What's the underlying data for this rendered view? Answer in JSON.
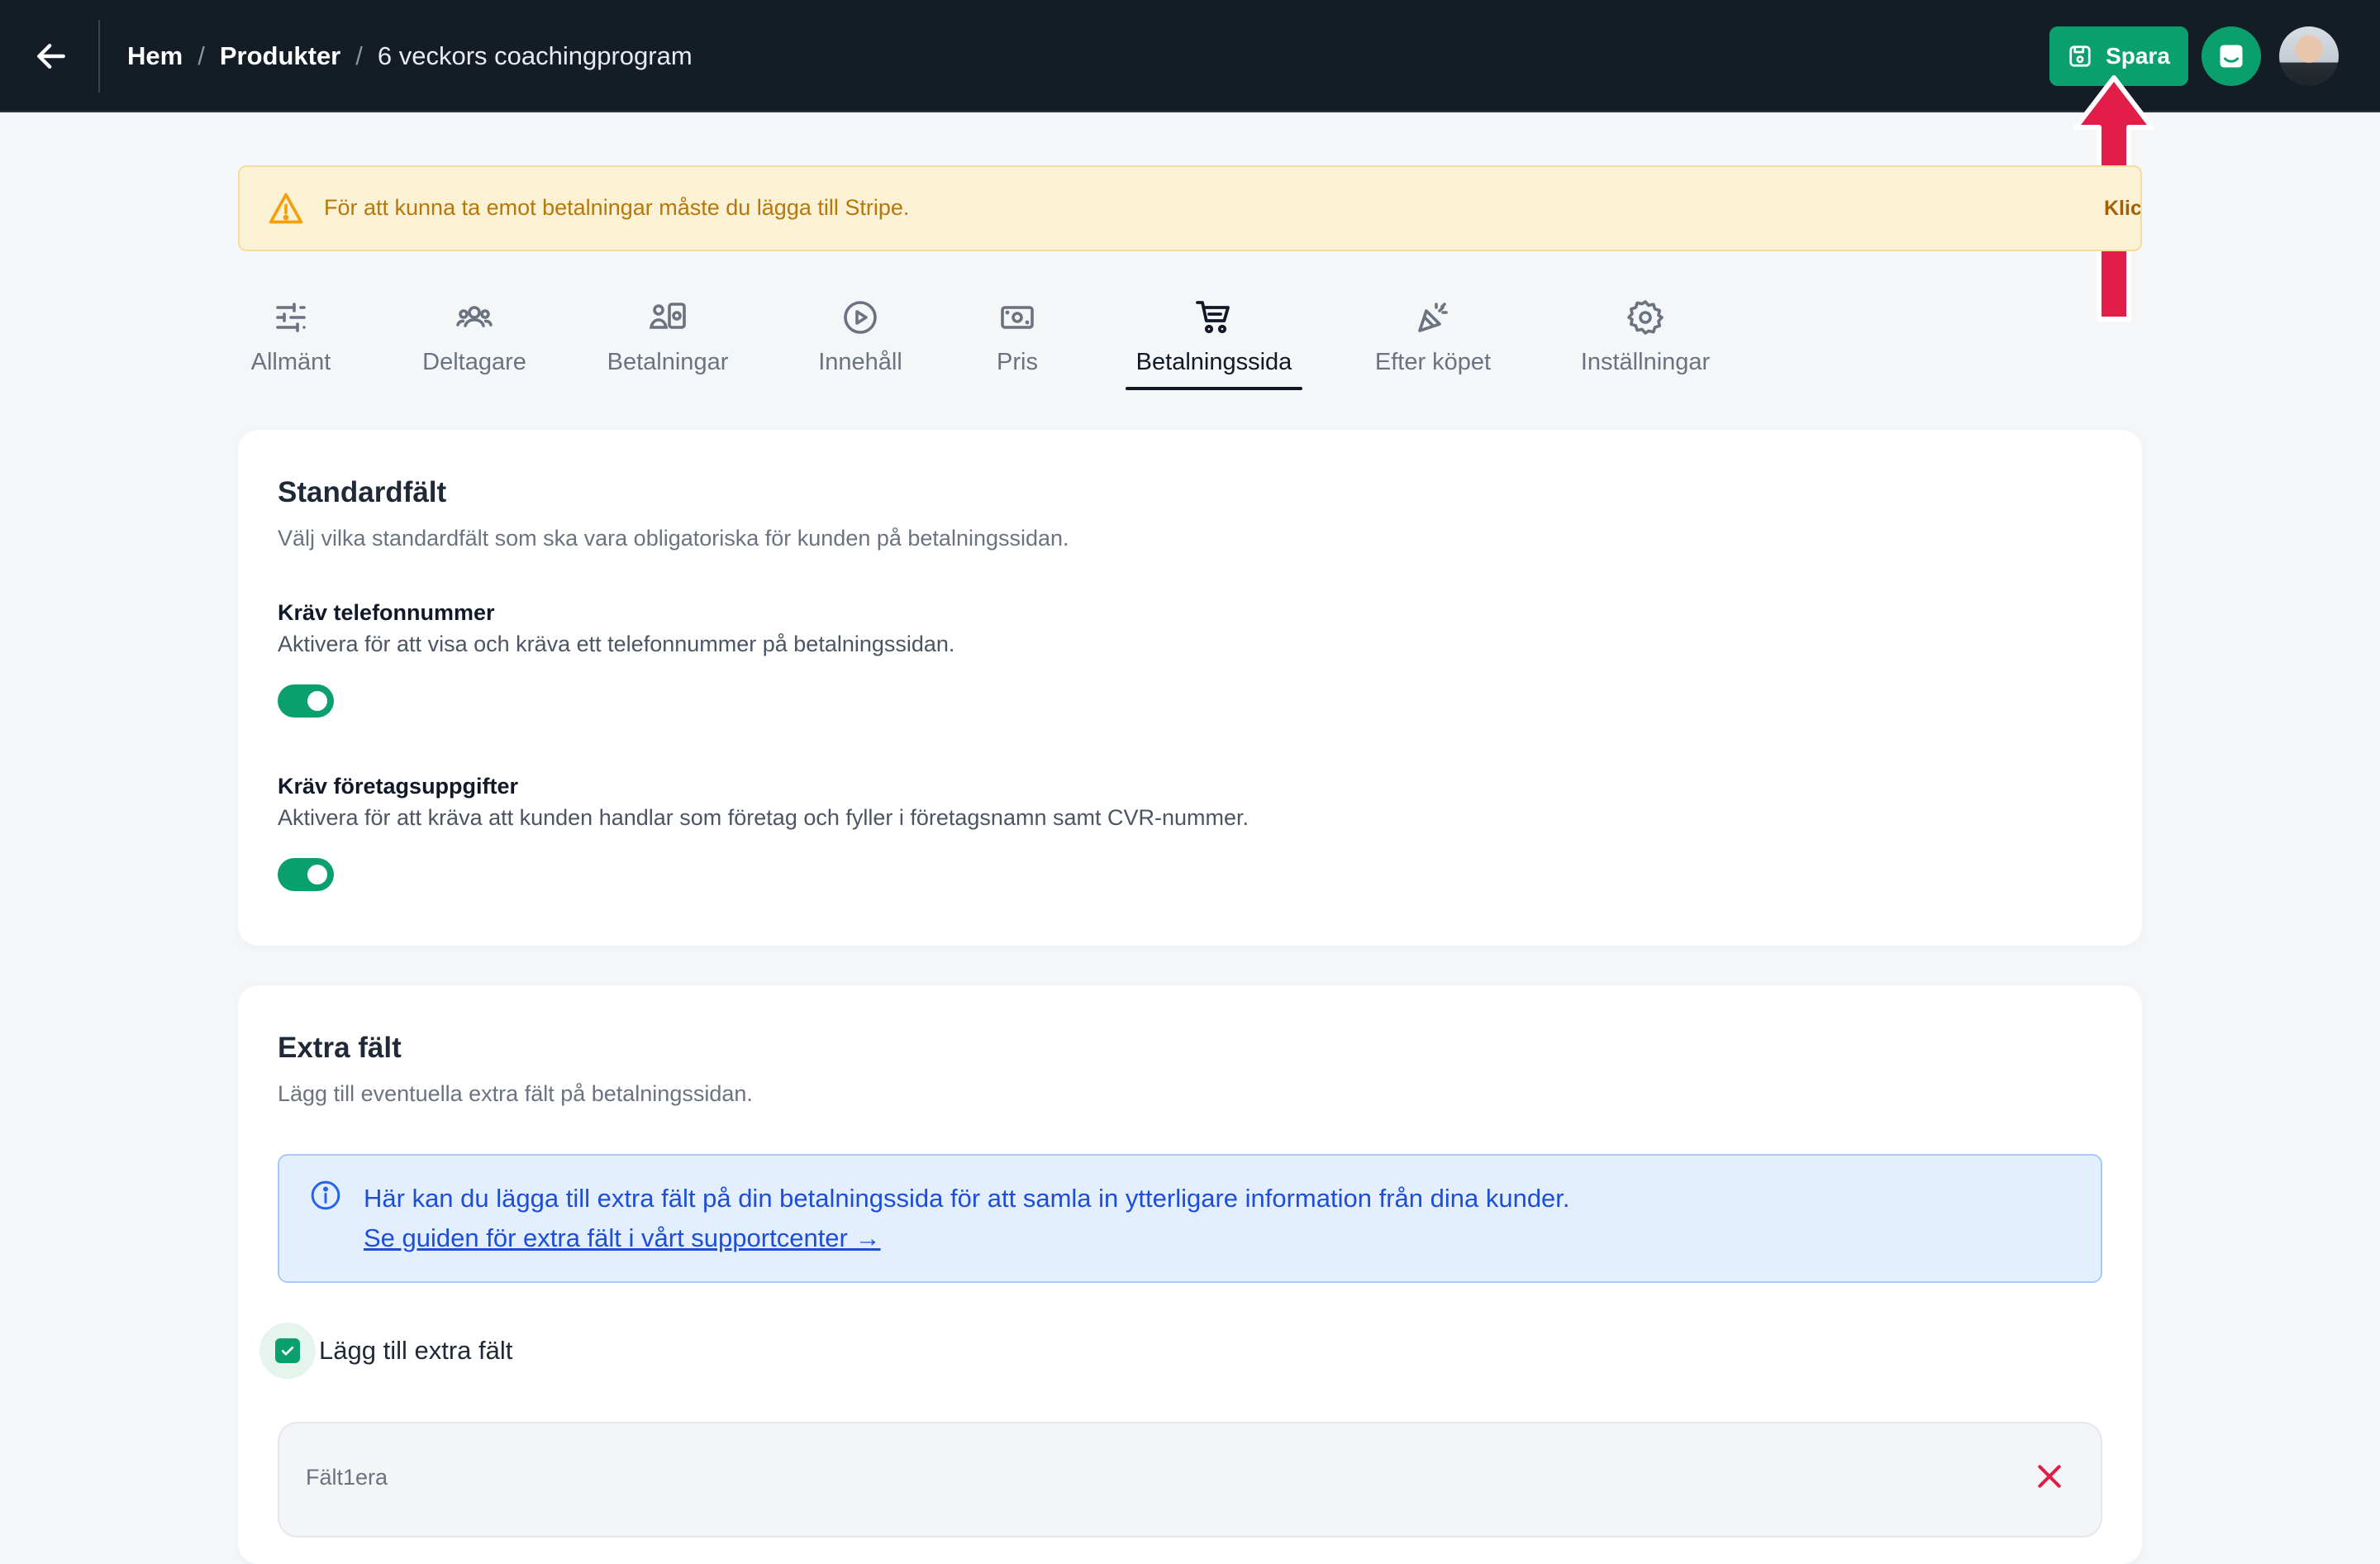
{
  "breadcrumb": {
    "items": [
      "Hem",
      "Produkter"
    ],
    "separator": "/",
    "current": "6 veckors coachingprogram"
  },
  "toolbar": {
    "save_label": "Spara",
    "save_color": "#0aa06e"
  },
  "alert": {
    "text": "För att kunna ta emot betalningar måste du lägga till Stripe.",
    "link": "Klicka här för att göra det",
    "icon": "warning-icon"
  },
  "tabs": [
    {
      "label": "Allmänt",
      "icon": "sliders-icon"
    },
    {
      "label": "Deltagare",
      "icon": "users-icon"
    },
    {
      "label": "Betalningar",
      "icon": "payments-icon"
    },
    {
      "label": "Innehåll",
      "icon": "play-icon"
    },
    {
      "label": "Pris",
      "icon": "money-icon"
    },
    {
      "label": "Betalningssida",
      "icon": "cart-icon",
      "active": true
    },
    {
      "label": "Efter köpet",
      "icon": "party-icon"
    },
    {
      "label": "Inställningar",
      "icon": "gear-icon"
    }
  ],
  "standard": {
    "title": "Standardfält",
    "desc": "Välj vilka standardfält som ska vara obligatoriska för kunden på betalningssidan.",
    "fields": [
      {
        "title": "Kräv telefonnummer",
        "desc": "Aktivera för att visa och kräva ett telefonnummer på betalningssidan.",
        "enabled": true
      },
      {
        "title": "Kräv företagsuppgifter",
        "desc": "Aktivera för att kräva att kunden handlar som företag och fyller i företagsnamn samt CVR-nummer.",
        "enabled": true
      }
    ]
  },
  "extra": {
    "title": "Extra fält",
    "desc": "Lägg till eventuella extra fält på betalningssidan.",
    "info_text": "Här kan du lägga till extra fält på din betalningssida för att samla in ytterligare information från dina kunder.",
    "info_link": "Se guiden för extra fält i vårt supportcenter →",
    "checkbox_label": "Lägg till extra fält",
    "checkbox_checked": true,
    "field_label": "Fält1era"
  }
}
